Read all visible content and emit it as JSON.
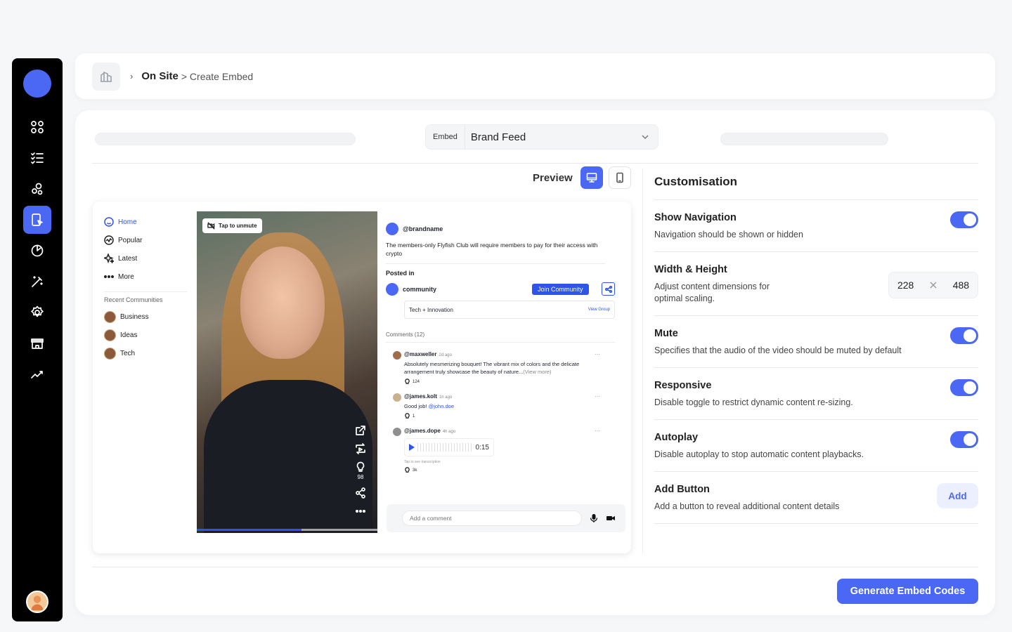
{
  "breadcrumb": {
    "separator": "›",
    "main": "On Site",
    "sub": "> Create Embed"
  },
  "embed": {
    "label": "Embed",
    "value": "Brand Feed"
  },
  "preview": {
    "label": "Preview"
  },
  "feed": {
    "nav": [
      {
        "label": "Home",
        "icon": "home-icon",
        "active": true
      },
      {
        "label": "Popular",
        "icon": "trending-icon"
      },
      {
        "label": "Latest",
        "icon": "sparkle-icon"
      },
      {
        "label": "More",
        "icon": "more-dots-icon"
      }
    ],
    "recent_title": "Recent Communities",
    "communities": [
      "Business",
      "Ideas",
      "Tech"
    ],
    "video": {
      "unmute": "Tap to unmute",
      "likes": "98",
      "progress_pct": 58
    },
    "post": {
      "author": "@brandname",
      "text": "The members-only Flyfish Club will require members to pay for their access with crypto",
      "posted_in": "Posted in",
      "community": "community",
      "join": "Join Community",
      "group": "Tech + Innovation",
      "view_group": "View Group"
    },
    "comments_title": "Comments (12)",
    "comments": [
      {
        "user": "@maxweller",
        "time": "2d ago",
        "body": "Absolutely mesmerizing bouquet! The vibrant mix of colors and the delicate arrangement truly showcase the beauty of nature...",
        "more": "(View more)",
        "likes": "124"
      },
      {
        "user": "@james.kolt",
        "time": "1h ago",
        "body": "Good job! ",
        "mention": "@john.doe",
        "likes": "1"
      },
      {
        "user": "@james.dope",
        "time": "4h ago",
        "audio_time": "0:15",
        "transcription": "Tap to see transcription",
        "likes": "3k"
      }
    ],
    "comment_placeholder": "Add a comment"
  },
  "customisation": {
    "title": "Customisation",
    "rows": [
      {
        "title": "Show Navigation",
        "desc": "Navigation should be shown or hidden",
        "enabled": true
      },
      {
        "title": "Width & Height",
        "desc": "Adjust content dimensions for optimal scaling.",
        "width": "228",
        "height": "488"
      },
      {
        "title": "Mute",
        "desc": "Specifies that the audio of the video should be muted by default",
        "enabled": true
      },
      {
        "title": "Responsive",
        "desc": "Disable toggle to restrict dynamic content re-sizing.",
        "enabled": true
      },
      {
        "title": "Autoplay",
        "desc": "Disable autoplay to stop automatic content playbacks.",
        "enabled": true
      },
      {
        "title": "Add Button",
        "desc": "Add a button to reveal additional content details",
        "button": "Add"
      }
    ]
  },
  "generate_button": "Generate Embed Codes",
  "colors": {
    "accent": "#4b68f5",
    "sidebar": "#000000",
    "link": "#2f54eb"
  }
}
